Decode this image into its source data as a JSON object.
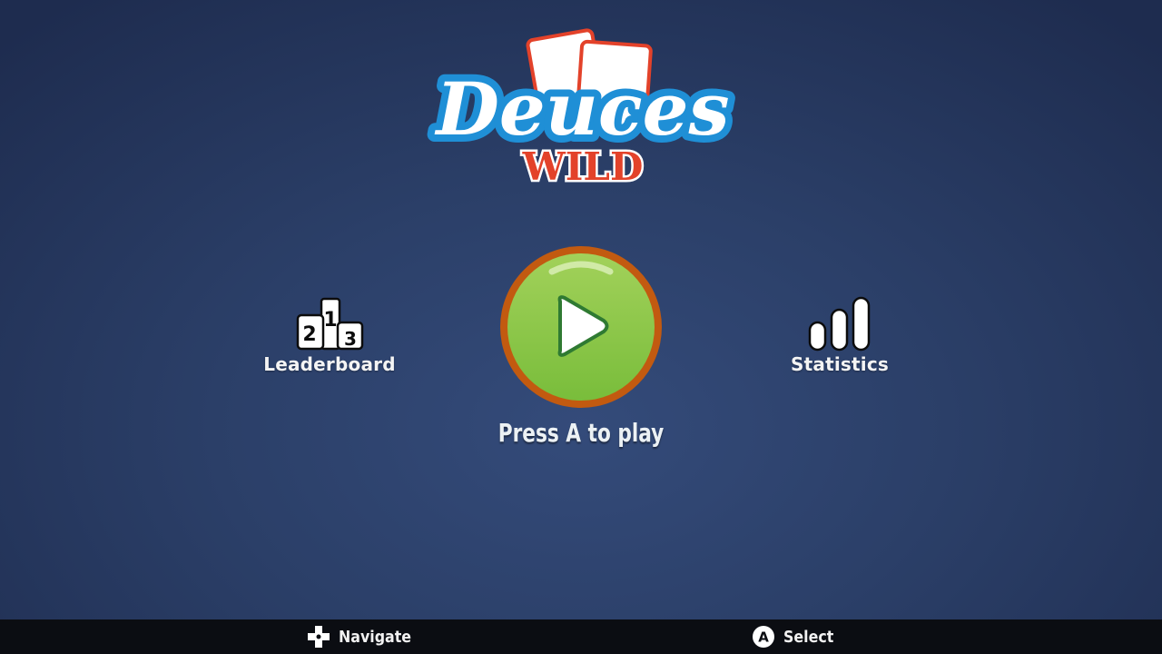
{
  "logo": {
    "title": "Deuces",
    "subtitle": "WILD",
    "colors": {
      "script_fill": "#ffffff",
      "script_outline": "#1f8fd6",
      "subtitle": "#e3422a",
      "card_border": "#e3422a"
    }
  },
  "menu": {
    "leaderboard": {
      "label": "Leaderboard",
      "icon": "podium-icon",
      "podium_numbers": [
        "2",
        "1",
        "3"
      ]
    },
    "play": {
      "icon": "play-icon",
      "prompt": "Press A to play",
      "colors": {
        "fill": "#8cc63f",
        "ring": "#c25a10"
      }
    },
    "statistics": {
      "label": "Statistics",
      "icon": "bar-chart-icon"
    }
  },
  "footer": {
    "navigate": {
      "icon": "dpad-icon",
      "label": "Navigate"
    },
    "select": {
      "icon": "a-button-icon",
      "button_letter": "A",
      "label": "Select"
    }
  }
}
